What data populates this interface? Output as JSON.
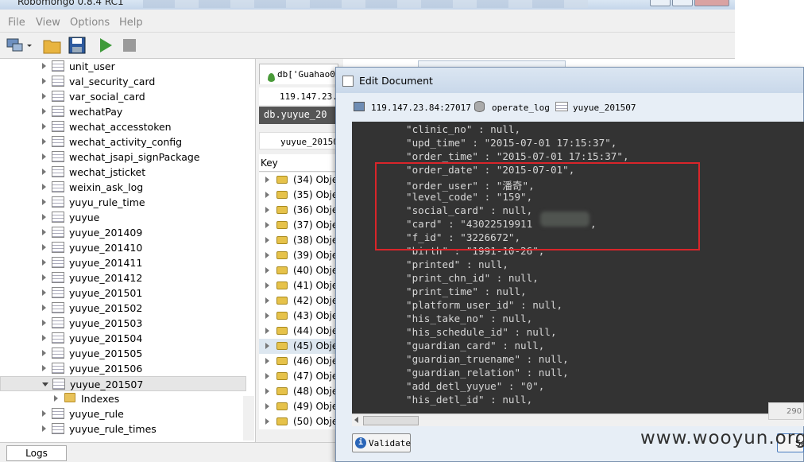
{
  "app": {
    "title": "Robomongo 0.8.4 RC1"
  },
  "menu": {
    "file": "File",
    "view": "View",
    "options": "Options",
    "help": "Help"
  },
  "tree": {
    "items": [
      {
        "label": "unit_user"
      },
      {
        "label": "val_security_card"
      },
      {
        "label": "var_social_card"
      },
      {
        "label": "wechatPay"
      },
      {
        "label": "wechat_accesstoken"
      },
      {
        "label": "wechat_activity_config"
      },
      {
        "label": "wechat_jsapi_signPackage"
      },
      {
        "label": "wechat_jsticket"
      },
      {
        "label": "weixin_ask_log"
      },
      {
        "label": "yuyu_rule_time"
      },
      {
        "label": "yuyue"
      },
      {
        "label": "yuyue_201409"
      },
      {
        "label": "yuyue_201410"
      },
      {
        "label": "yuyue_201411"
      },
      {
        "label": "yuyue_201412"
      },
      {
        "label": "yuyue_201501"
      },
      {
        "label": "yuyue_201502"
      },
      {
        "label": "yuyue_201503"
      },
      {
        "label": "yuyue_201504"
      },
      {
        "label": "yuyue_201505"
      },
      {
        "label": "yuyue_201506"
      },
      {
        "label": "yuyue_201507"
      },
      {
        "label": "Indexes"
      },
      {
        "label": "yuyue_rule"
      },
      {
        "label": "yuyue_rule_times"
      }
    ],
    "selected": "yuyue_201507"
  },
  "logs": {
    "tab": "Logs"
  },
  "query_tab": {
    "tab_label": "db['Guahao0u",
    "server": "119.147.23.8",
    "query": "db.yuyue_20",
    "collection": "yuyue_20150",
    "key_header": "Key",
    "rows": [
      {
        "label": "(34) Obje"
      },
      {
        "label": "(35) Obje"
      },
      {
        "label": "(36) Obje"
      },
      {
        "label": "(37) Obje"
      },
      {
        "label": "(38) Obje"
      },
      {
        "label": "(39) Obje"
      },
      {
        "label": "(40) Obje"
      },
      {
        "label": "(41) Obje"
      },
      {
        "label": "(42) Obje"
      },
      {
        "label": "(43) Obje"
      },
      {
        "label": "(44) Obje"
      },
      {
        "label": "(45) Obje"
      },
      {
        "label": "(46) Obje"
      },
      {
        "label": "(47) Obje"
      },
      {
        "label": "(48) Obje"
      },
      {
        "label": "(49) Obje"
      },
      {
        "label": "(50) Obje"
      }
    ],
    "selected_row": "(45) Obje"
  },
  "dialog": {
    "title": "Edit Document",
    "server": "119.147.23.84:27017",
    "database": "operate_log",
    "collection": "yuyue_201507",
    "lines": [
      "\"clinic_no\" : null,",
      "\"upd_time\" : \"2015-07-01 17:15:37\",",
      "\"order_time\" : \"2015-07-01 17:15:37\",",
      "\"order_date\" : \"2015-07-01\",",
      "\"order_user\" : \"潘奇\",",
      "\"level_code\" : \"159\",",
      "\"social_card\" : null,",
      "\"card\" : \"43022519911",
      "\"f_id\" : \"3226672\",",
      "\"birth\" : \"1991-10-26\",",
      "\"printed\" : null,",
      "\"print_chn_id\" : null,",
      "\"print_time\" : null,",
      "\"platform_user_id\" : null,",
      "\"his_take_no\" : null,",
      "\"his_schedule_id\" : null,",
      "\"guardian_card\" : null,",
      "\"guardian_truename\" : null,",
      "\"guardian_relation\" : null,",
      "\"add_detl_yuyue\" : \"0\",",
      "\"his_detl_id\" : null,"
    ],
    "card_tail": ",",
    "validate_label": "Validate",
    "save_label": "Sa"
  },
  "side_badge": "290",
  "watermark": "www.wooyun.org",
  "colors": {
    "editor_bg": "#333333",
    "highlight_red": "#d9252a",
    "selected_tab": "#555555"
  }
}
